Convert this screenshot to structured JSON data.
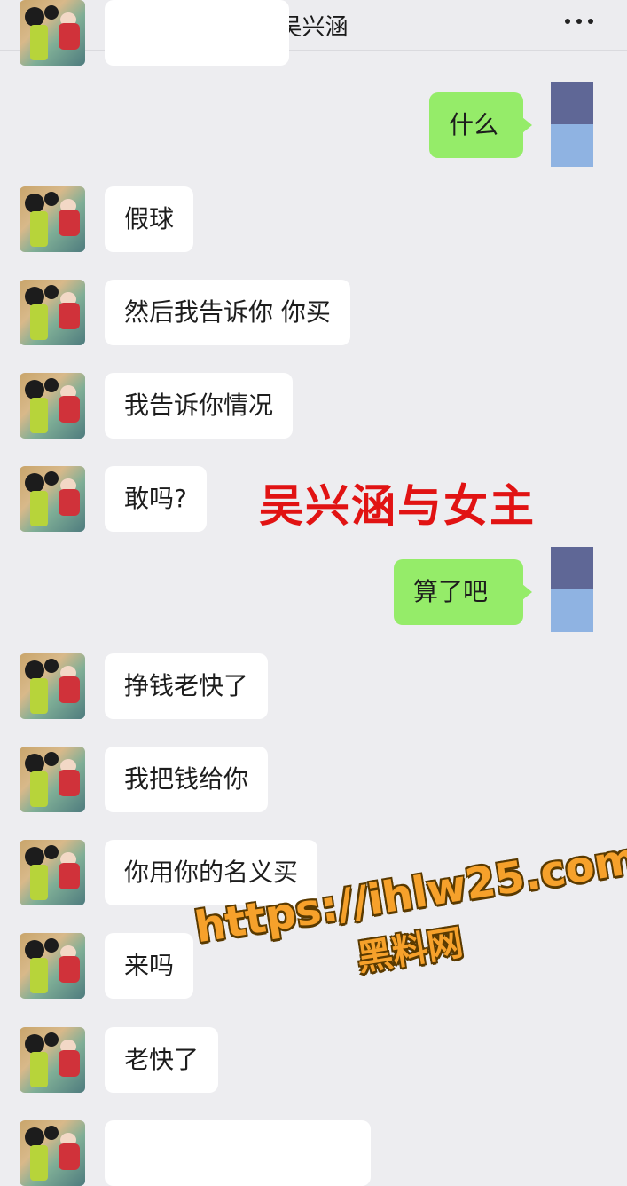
{
  "header": {
    "title": "吴兴涵",
    "back_icon": "chevron-left-icon",
    "more_icon": "more-dots-icon"
  },
  "messages": [
    {
      "from": "self",
      "text": "什么"
    },
    {
      "from": "other",
      "text": "假球"
    },
    {
      "from": "other",
      "text": "然后我告诉你 你买"
    },
    {
      "from": "other",
      "text": "我告诉你情况"
    },
    {
      "from": "other",
      "text": "敢吗?"
    },
    {
      "from": "self",
      "text": "算了吧"
    },
    {
      "from": "other",
      "text": "挣钱老快了"
    },
    {
      "from": "other",
      "text": "我把钱给你"
    },
    {
      "from": "other",
      "text": "你用你的名义买"
    },
    {
      "from": "other",
      "text": "来吗"
    },
    {
      "from": "other",
      "text": "老快了"
    }
  ],
  "overlay": {
    "caption": "吴兴涵与女主",
    "url": "https://ihlw25.com",
    "site_name": "黑料网"
  },
  "colors": {
    "self_bubble": "#95ec69",
    "other_bubble": "#ffffff",
    "background": "#ededf0",
    "caption": "#e11313",
    "url": "#f6a12b"
  }
}
